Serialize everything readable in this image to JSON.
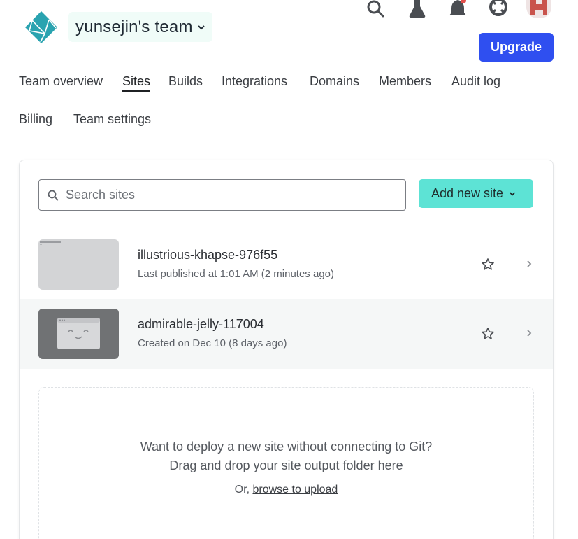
{
  "header": {
    "team_name": "yunsejin's team",
    "upgrade_label": "Upgrade"
  },
  "nav": {
    "items": [
      {
        "label": "Team overview",
        "active": false
      },
      {
        "label": "Sites",
        "active": true
      },
      {
        "label": "Builds",
        "active": false
      },
      {
        "label": "Integrations",
        "active": false
      },
      {
        "label": "Domains",
        "active": false
      },
      {
        "label": "Members",
        "active": false
      },
      {
        "label": "Audit log",
        "active": false
      },
      {
        "label": "Billing",
        "active": false
      },
      {
        "label": "Team settings",
        "active": false
      }
    ]
  },
  "sites_panel": {
    "search_placeholder": "Search sites",
    "add_label": "Add new site",
    "sites": [
      {
        "name": "illustrious-khapse-976f55",
        "meta": "Last published at 1:01 AM (2 minutes ago)"
      },
      {
        "name": "admirable-jelly-117004",
        "meta": "Created on Dec 10 (8 days ago)"
      }
    ],
    "dropzone": {
      "line1": "Want to deploy a new site without connecting to Git?",
      "line2": "Drag and drop your site output folder here",
      "or_prefix": "Or,",
      "browse_label": "browse to upload"
    }
  },
  "colors": {
    "accent": "#2f4ff0",
    "teal": "#5de3d5",
    "logo": "#2aa3b0"
  },
  "icons": [
    "netlify-logo-icon",
    "search-icon",
    "flask-icon",
    "bell-icon",
    "lifebuoy-icon",
    "star-icon",
    "chevron-right-icon",
    "chevron-down-icon"
  ]
}
